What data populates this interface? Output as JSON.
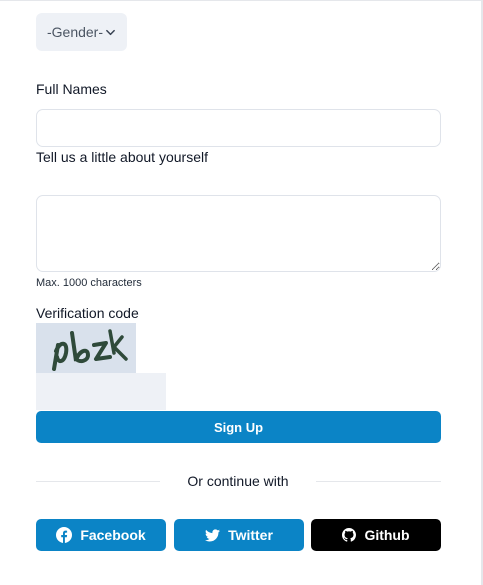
{
  "colors": {
    "primary": "#0b84c6",
    "github": "#000000",
    "field_bg": "#eef1f6",
    "border": "#dfe3ea"
  },
  "gender": {
    "selected": "-Gender-"
  },
  "full_name": {
    "label": "Full Names",
    "value": ""
  },
  "about": {
    "label": "Tell us a little about yourself",
    "value": "",
    "hint": "Max. 1000 characters"
  },
  "verification": {
    "label": "Verification code",
    "captcha_text": "pbzk",
    "value": ""
  },
  "signup": {
    "label": "Sign Up"
  },
  "divider": {
    "text": "Or continue with"
  },
  "social": {
    "facebook": {
      "label": "Facebook",
      "icon": "facebook-icon"
    },
    "twitter": {
      "label": "Twitter",
      "icon": "twitter-icon"
    },
    "github": {
      "label": "Github",
      "icon": "github-icon"
    }
  }
}
